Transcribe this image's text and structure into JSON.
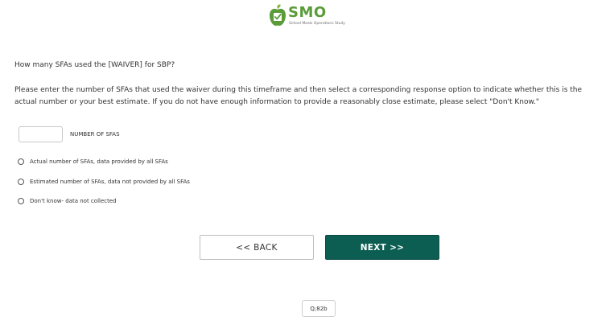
{
  "header": {
    "logo_text": "SMO",
    "logo_tagline": "School Meals Operations Study",
    "logo_icon": "apple-checkbox-icon",
    "brand_color": "#5a9b3a"
  },
  "question": {
    "text": "How many SFAs used the [WAIVER] for SBP?",
    "instructions": "Please enter the number of SFAs that used the waiver during this timeframe and then select a corresponding response option to indicate whether this is the actual number or your best estimate. If you do not have enough information to provide a reasonably close estimate, please select \"Don't Know.\""
  },
  "number_input": {
    "value": "",
    "label": "NUMBER OF SFAS"
  },
  "options": [
    {
      "label": "Actual number of SFAs, data provided by all SFAs",
      "selected": false
    },
    {
      "label": "Estimated number of SFAs, data not provided by all SFAs",
      "selected": false
    },
    {
      "label": "Don't know- data not collected",
      "selected": false
    }
  ],
  "navigation": {
    "back_label": "<< BACK",
    "next_label": "NEXT >>",
    "next_color": "#0d5e52"
  },
  "question_id": "Q;82b"
}
